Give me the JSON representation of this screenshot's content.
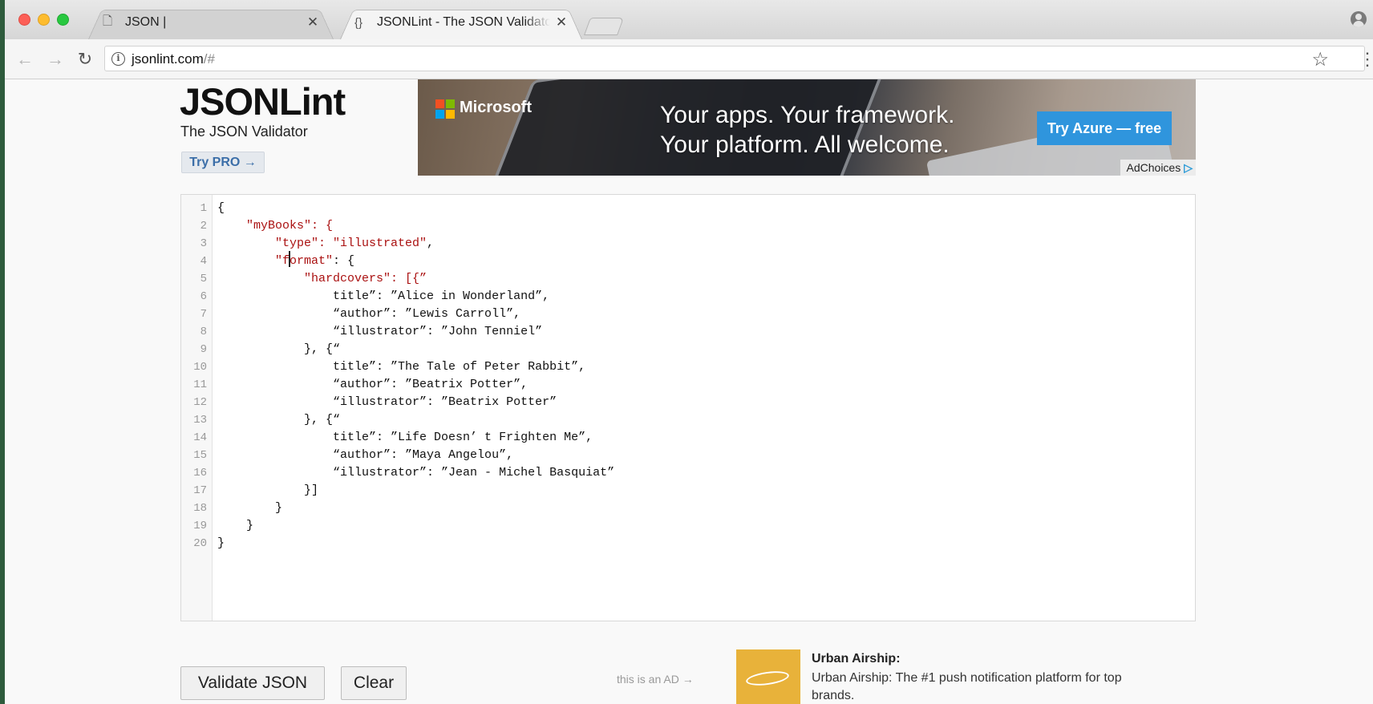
{
  "browser": {
    "tabs": [
      {
        "title": "JSON |",
        "icon": "page-icon"
      },
      {
        "title": "JSONLint - The JSON Validator",
        "icon": "curly-braces-icon"
      }
    ],
    "url": {
      "host": "jsonlint.com",
      "path": "/#"
    }
  },
  "header": {
    "logo": "JSONLint",
    "tagline": "The JSON Validator",
    "try_pro": "Try PRO →"
  },
  "ad_banner": {
    "brand": "Microsoft",
    "headline_1": "Your apps. Your framework.",
    "headline_2": "Your platform. All welcome.",
    "cta": "Try Azure — free",
    "adchoices": "AdChoices",
    "colors": {
      "cta": "#2f95dd",
      "ms_red": "#f25022",
      "ms_green": "#7fba00",
      "ms_blue": "#00a4ef",
      "ms_yellow": "#ffb900"
    }
  },
  "editor": {
    "lines": [
      {
        "n": "1",
        "indent": "",
        "key": "",
        "rest": "{"
      },
      {
        "n": "2",
        "indent": "    ",
        "key": "\"myBooks\": {",
        "rest": ""
      },
      {
        "n": "3",
        "indent": "        ",
        "key": "\"type\": \"illustrated\"",
        "rest": ","
      },
      {
        "n": "4",
        "indent": "        ",
        "key": "\"format\"",
        "rest": ": {"
      },
      {
        "n": "5",
        "indent": "            ",
        "key": "\"hardcovers\": [{”",
        "rest": ""
      },
      {
        "n": "6",
        "indent": "                ",
        "key": "",
        "rest": "title”: ”Alice in Wonderland”,"
      },
      {
        "n": "7",
        "indent": "                ",
        "key": "",
        "rest": "“author”: ”Lewis Carroll”,"
      },
      {
        "n": "8",
        "indent": "                ",
        "key": "",
        "rest": "“illustrator”: ”John Tenniel”"
      },
      {
        "n": "9",
        "indent": "            ",
        "key": "",
        "rest": "}, {“"
      },
      {
        "n": "10",
        "indent": "                ",
        "key": "",
        "rest": "title”: ”The Tale of Peter Rabbit”,"
      },
      {
        "n": "11",
        "indent": "                ",
        "key": "",
        "rest": "“author”: ”Beatrix Potter”,"
      },
      {
        "n": "12",
        "indent": "                ",
        "key": "",
        "rest": "“illustrator”: ”Beatrix Potter”"
      },
      {
        "n": "13",
        "indent": "            ",
        "key": "",
        "rest": "}, {“"
      },
      {
        "n": "14",
        "indent": "                ",
        "key": "",
        "rest": "title”: ”Life Doesn’ t Frighten Me”,"
      },
      {
        "n": "15",
        "indent": "                ",
        "key": "",
        "rest": "“author”: ”Maya Angelou”,"
      },
      {
        "n": "16",
        "indent": "                ",
        "key": "",
        "rest": "“illustrator”: ”Jean - Michel Basquiat”"
      },
      {
        "n": "17",
        "indent": "            ",
        "key": "",
        "rest": "}]"
      },
      {
        "n": "18",
        "indent": "        ",
        "key": "",
        "rest": "}"
      },
      {
        "n": "19",
        "indent": "    ",
        "key": "",
        "rest": "}"
      },
      {
        "n": "20",
        "indent": "",
        "key": "",
        "rest": "}"
      }
    ]
  },
  "actions": {
    "validate": "Validate JSON",
    "clear": "Clear"
  },
  "bottom_ad": {
    "note": "this is an AD →",
    "title": "Urban Airship:",
    "description": "Urban Airship: The #1 push notification platform for top brands."
  }
}
